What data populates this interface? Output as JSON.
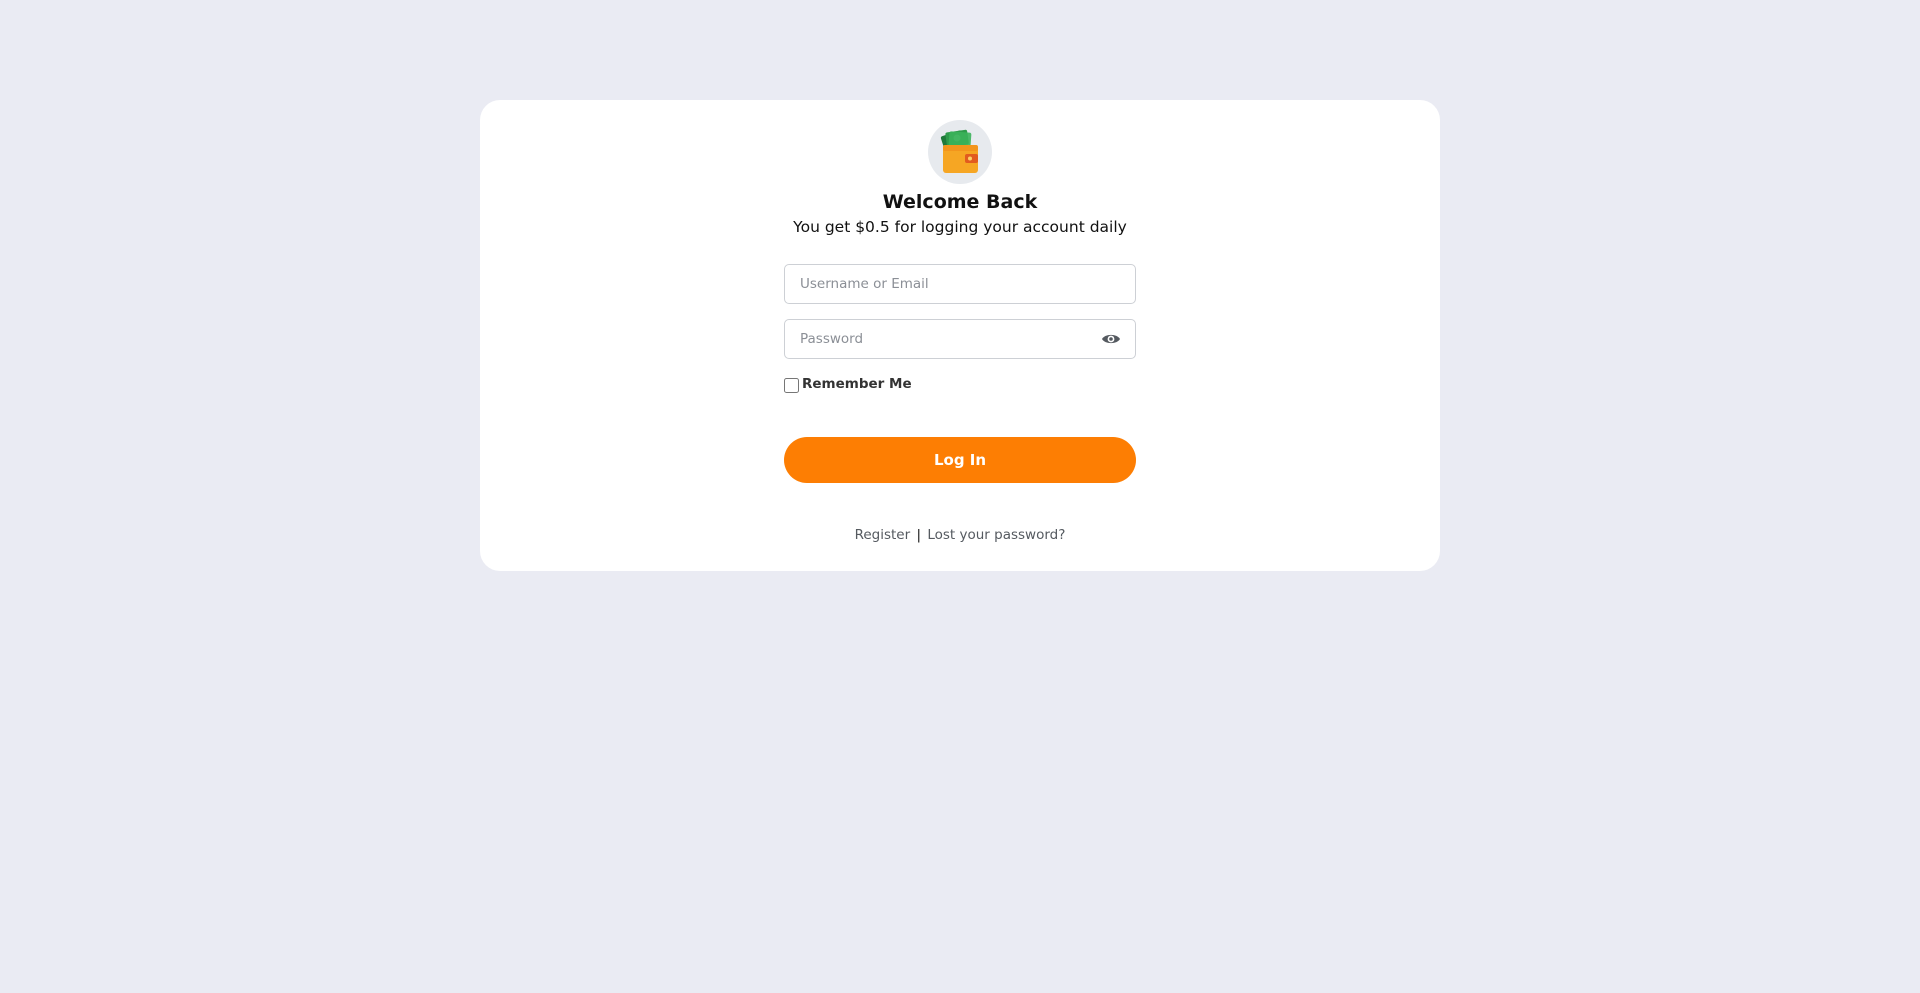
{
  "login": {
    "title": "Welcome Back",
    "subtitle": "You get $0.5 for logging your account daily",
    "logo_icon": "wallet-money-icon",
    "username_placeholder": "Username or Email",
    "username_value": "",
    "password_placeholder": "Password",
    "password_value": "",
    "password_toggle_icon": "eye-icon",
    "remember_me_label": "Remember Me",
    "remember_me_checked": false,
    "login_button_label": "Log In",
    "register_link": "Register",
    "separator": "|",
    "lost_password_link": "Lost your password?"
  },
  "colors": {
    "page_background": "#eaebf3",
    "card_background": "#ffffff",
    "accent": "#fd7e03",
    "wallet": "#f6a623",
    "money": "#2e9b4a"
  }
}
